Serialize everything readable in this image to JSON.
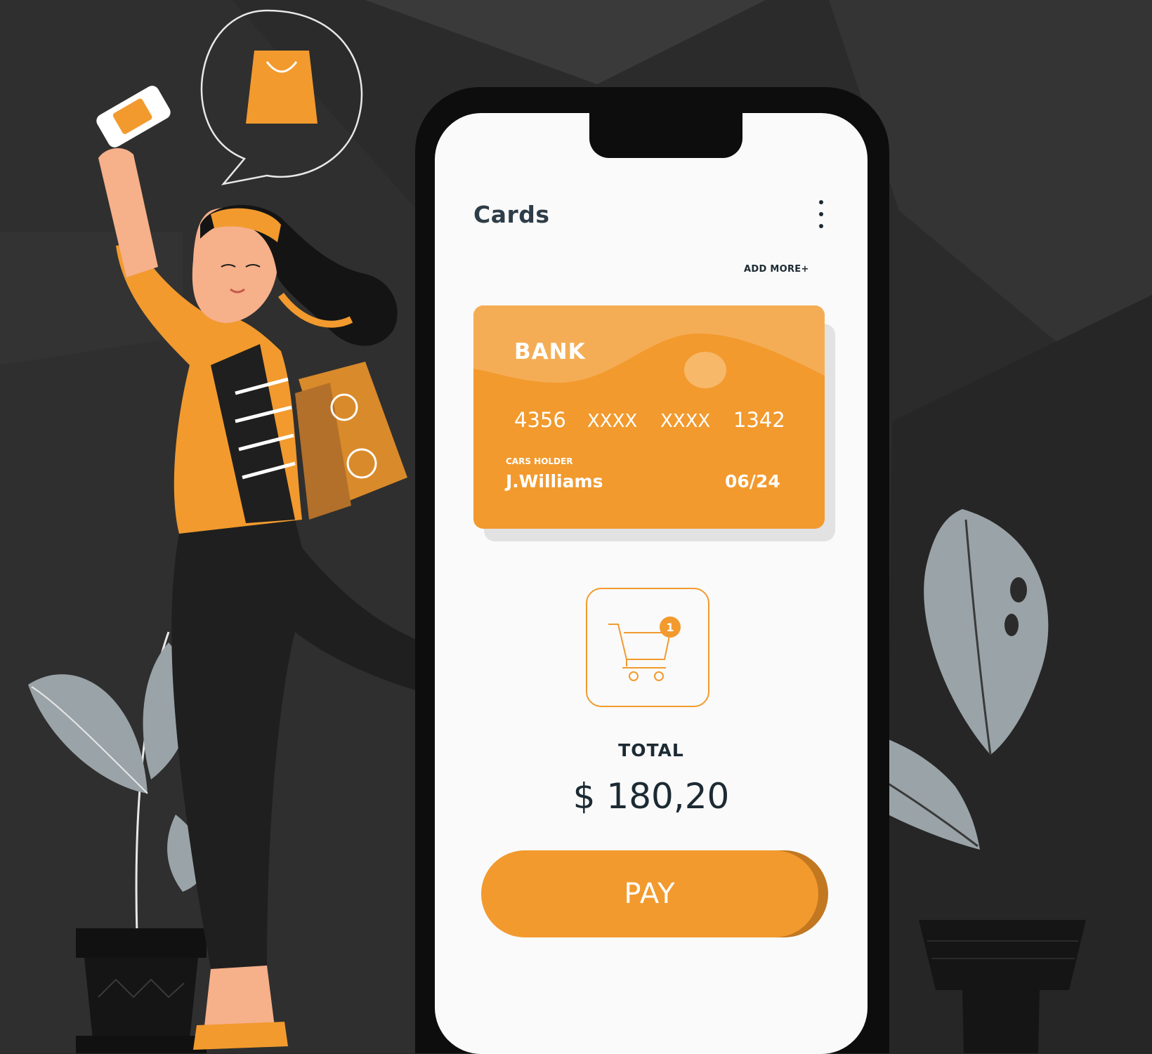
{
  "screen": {
    "title": "Cards",
    "menu_icon": "more-vertical-icon",
    "add_more_label": "ADD MORE+"
  },
  "card": {
    "bank": "BANK",
    "number_groups": [
      "4356",
      "XXXX",
      "XXXX",
      "1342"
    ],
    "holder_label": "CARS HOLDER",
    "holder_name": "J.Williams",
    "expiry": "06/24"
  },
  "cart": {
    "icon": "shopping-cart-icon",
    "badge_count": "1"
  },
  "total": {
    "label": "TOTAL",
    "amount": "$ 180,20"
  },
  "pay_button_label": "PAY",
  "colors": {
    "background": "#2b2b2b",
    "accent": "#f29a2e",
    "accent_dark": "#c27721",
    "screen": "#fafafa",
    "text_dark": "#1c2a33",
    "leaf": "#9aa4a8"
  }
}
